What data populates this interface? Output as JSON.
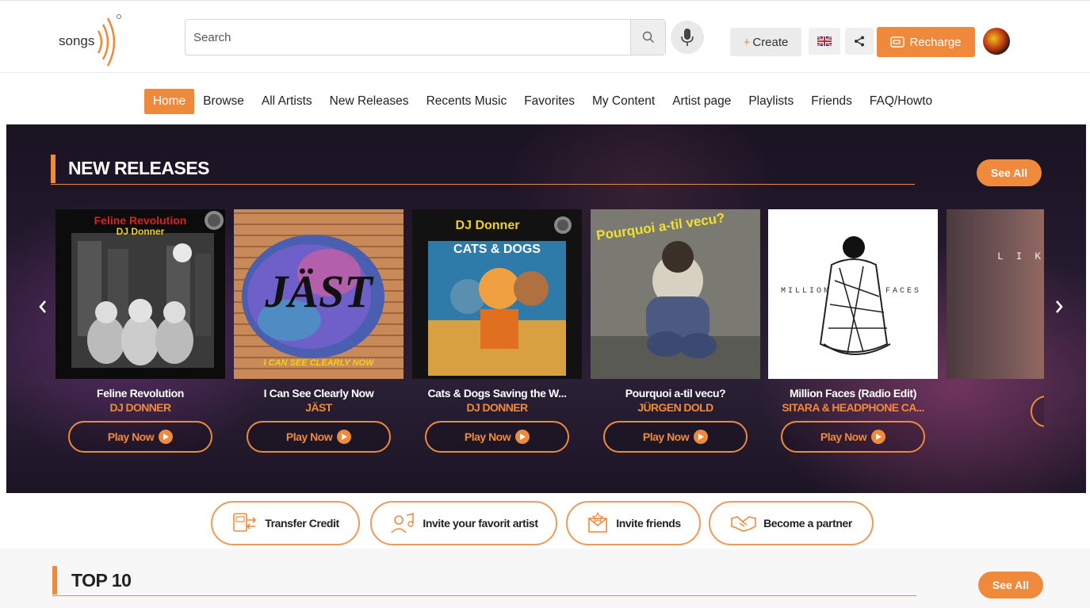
{
  "header": {
    "logo_text": "songs",
    "search_placeholder": "Search",
    "create_label": "Create",
    "recharge_label": "Recharge",
    "accent_color": "#ef8a3d"
  },
  "nav": {
    "items": [
      "Home",
      "Browse",
      "All Artists",
      "New Releases",
      "Recents Music",
      "Favorites",
      "My Content",
      "Artist page",
      "Playlists",
      "Friends",
      "FAQ/Howto"
    ],
    "active": "Home"
  },
  "new_releases": {
    "title": "NEW RELEASES",
    "see_all": "See All",
    "play_label": "Play Now",
    "items": [
      {
        "title": "Feline Revolution",
        "artist": "DJ DONNER",
        "cover_text": "Feline Revolution",
        "cover_sub": "DJ Donner"
      },
      {
        "title": "I Can See Clearly Now",
        "artist": "JÄST",
        "cover_text": "JÄST",
        "cover_sub": "I CAN SEE CLEARLY NOW"
      },
      {
        "title": "Cats & Dogs Saving the W...",
        "artist": "DJ DONNER",
        "cover_text": "DJ Donner",
        "cover_sub": "CATS & DOGS"
      },
      {
        "title": "Pourquoi a-til vecu?",
        "artist": "JÜRGEN DOLD",
        "cover_text": "Pourquoi a-til vecu?",
        "cover_sub": ""
      },
      {
        "title": "Million Faces (Radio Edit)",
        "artist": "SITARA & HEADPHONE CA...",
        "cover_text": "MILLION",
        "cover_sub": "FACES"
      },
      {
        "title": "",
        "artist": "",
        "cover_text": "L I K E",
        "cover_sub": ""
      }
    ]
  },
  "actions": [
    {
      "label": "Transfer Credit",
      "icon": "credit-transfer-icon"
    },
    {
      "label": "Invite your favorit artist",
      "icon": "invite-artist-icon"
    },
    {
      "label": "Invite friends",
      "icon": "invite-friends-icon"
    },
    {
      "label": "Become a partner",
      "icon": "handshake-icon"
    }
  ],
  "top10": {
    "title": "TOP 10",
    "see_all": "See All"
  }
}
